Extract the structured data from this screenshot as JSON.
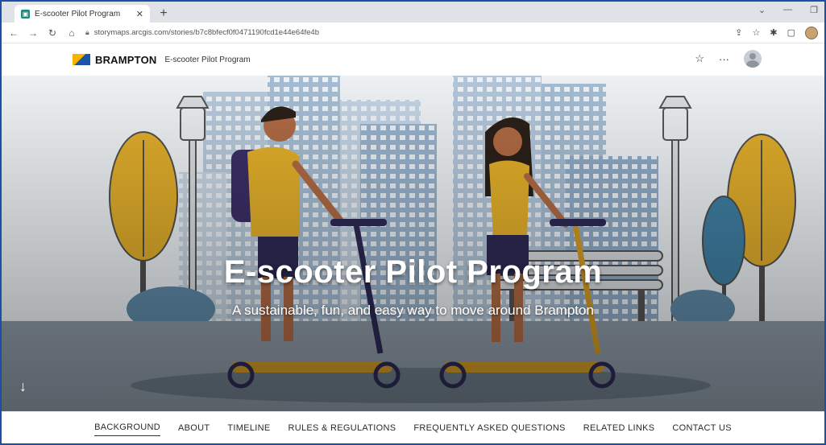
{
  "browser": {
    "tab_title": "E-scooter Pilot Program",
    "tab_favicon": "storymaps-icon",
    "new_tab": "+",
    "url": "storymaps.arcgis.com/stories/b7c8bfecf0f0471190fcd1e44e64fe4b"
  },
  "site": {
    "brand_name": "BRAMPTON",
    "program_name": "E-scooter Pilot Program"
  },
  "hero": {
    "title": "E-scooter Pilot Program",
    "subtitle": "A sustainable, fun, and easy way to move around Brampton",
    "scroll_icon": "↓"
  },
  "nav": {
    "items": [
      {
        "label": "BACKGROUND",
        "active": true
      },
      {
        "label": "ABOUT"
      },
      {
        "label": "TIMELINE"
      },
      {
        "label": "RULES & REGULATIONS"
      },
      {
        "label": "FREQUENTLY ASKED QUESTIONS"
      },
      {
        "label": "RELATED LINKS"
      },
      {
        "label": "CONTACT US"
      }
    ]
  },
  "colors": {
    "accent_border": "#1a4fa3",
    "yellow": "#e3b02a",
    "navy": "#2d2a55",
    "building_blue": "#a7c0d8",
    "ground": "#7c8b98"
  }
}
